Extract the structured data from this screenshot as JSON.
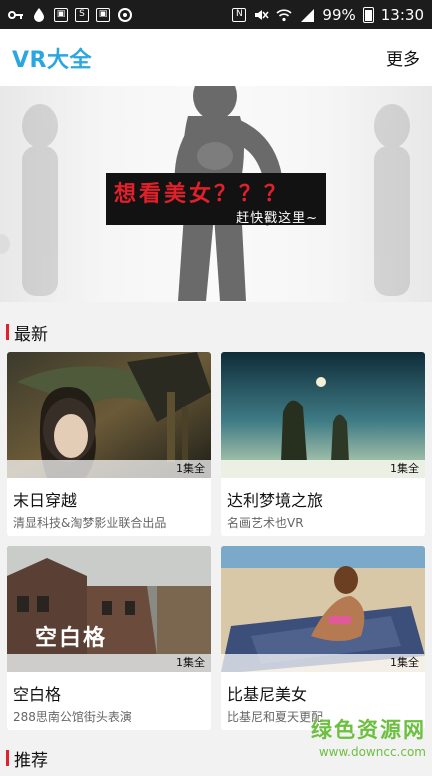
{
  "status_bar": {
    "battery": "99%",
    "time": "13:30",
    "icons": [
      "key-icon",
      "water-drop-icon",
      "bag-icon",
      "s-icon",
      "bag-icon",
      "target-icon",
      "nfc-icon",
      "mute-icon",
      "wifi-icon",
      "signal-icon",
      "battery-icon"
    ]
  },
  "app_bar": {
    "title": "VR大全",
    "more_label": "更多"
  },
  "banner": {
    "title": "想看美女？？？",
    "subtitle": "赶快戳这里~"
  },
  "sections": {
    "latest": {
      "title": "最新"
    },
    "recommend": {
      "title": "推荐"
    }
  },
  "cards": [
    {
      "title": "末日穿越",
      "description": "清显科技&淘梦影业联合出品",
      "episodes": "1集全"
    },
    {
      "title": "达利梦境之旅",
      "description": "名画艺术也VR",
      "episodes": "1集全"
    },
    {
      "title": "空白格",
      "description": "288思南公馆街头表演",
      "episodes": "1集全",
      "poster_text": "空白格"
    },
    {
      "title": "比基尼美女",
      "description": "比基尼和夏天更配",
      "episodes": "1集全"
    }
  ],
  "watermark": {
    "text": "绿色资源网",
    "url": "www.downcc.com"
  },
  "colors": {
    "accent": "#2aa7e0",
    "section_marker": "#e0202a",
    "banner_title": "#e0202a",
    "watermark": "#6cbf3f"
  }
}
